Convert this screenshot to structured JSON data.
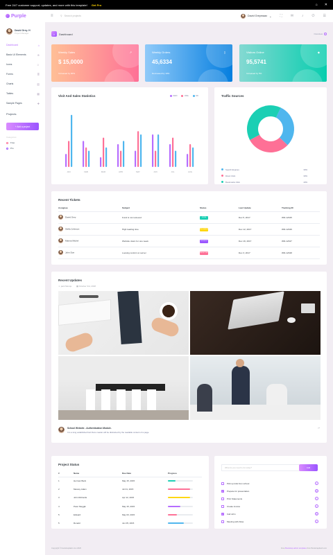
{
  "announcement": {
    "text": "Free 24/7 customer support, updates, and more with this template!",
    "cta": "Get Pro"
  },
  "topbar": {
    "brand": "Purple",
    "search_placeholder": "Search projects",
    "user": "David Greymaax"
  },
  "sidebar": {
    "profile_name": "David Grey. H",
    "profile_role": "Project Manager",
    "items": [
      {
        "label": "Dashboard",
        "icon": "home-icon"
      },
      {
        "label": "Basic UI Elements",
        "icon": "crosshairs-icon"
      },
      {
        "label": "Icons",
        "icon": "contacts-icon"
      },
      {
        "label": "Forms",
        "icon": "format-list-icon"
      },
      {
        "label": "Charts",
        "icon": "chart-bar-icon"
      },
      {
        "label": "Tables",
        "icon": "table-icon"
      },
      {
        "label": "Sample Pages",
        "icon": "medical-bag-icon"
      }
    ],
    "projects_title": "Projects",
    "add_project": "+ Add a project",
    "categories_title": "Categories",
    "categories": [
      "Free",
      "Pro"
    ]
  },
  "page": {
    "title": "Dashboard",
    "overview": "Overview"
  },
  "stats": [
    {
      "label": "Weekly Sales",
      "value": "$ 15,0000",
      "sub": "Increased by 60%",
      "icon": "chart-line-icon"
    },
    {
      "label": "Weekly Orders",
      "value": "45,6334",
      "sub": "Decreased by 10%",
      "icon": "bookmark-icon"
    },
    {
      "label": "Visitors Online",
      "value": "95,5741",
      "sub": "Increased by 5%",
      "icon": "diamond-icon"
    }
  ],
  "visit_chart": {
    "title": "Visit And Sales Statistics",
    "colors": {
      "CHN": "#b66dff",
      "USA": "#fe7096",
      "UK": "#4fb6ee"
    },
    "chart_data": {
      "type": "bar",
      "categories": [
        "JAN",
        "FEB",
        "MAR",
        "APR",
        "MAY",
        "JUN",
        "JUL",
        "AUG"
      ],
      "series": [
        {
          "name": "CHN",
          "values": [
            20,
            40,
            15,
            35,
            25,
            50,
            35,
            20
          ]
        },
        {
          "name": "USA",
          "values": [
            40,
            30,
            45,
            25,
            55,
            25,
            45,
            35
          ]
        },
        {
          "name": "UK",
          "values": [
            80,
            25,
            30,
            40,
            50,
            50,
            25,
            30
          ]
        }
      ],
      "ylim": [
        0,
        85
      ]
    }
  },
  "traffic": {
    "title": "Traffic Sources",
    "chart_data": {
      "type": "pie",
      "categories": [
        "Search Engines",
        "Direct Click",
        "Bookmarks Click"
      ],
      "values": [
        30,
        30,
        40
      ],
      "colors": [
        "#4fb6ee",
        "#fe7096",
        "#1bcfb4"
      ]
    },
    "legend": [
      {
        "label": "Search Engines",
        "pct": "30%"
      },
      {
        "label": "Direct Click",
        "pct": "30%"
      },
      {
        "label": "Bookmarks Click",
        "pct": "40%"
      }
    ]
  },
  "tickets": {
    "title": "Recent Tickets",
    "headers": [
      "Assignee",
      "Subject",
      "Status",
      "Last Update",
      "Tracking ID"
    ],
    "rows": [
      {
        "name": "David Grey",
        "subject": "Fund is not recieved",
        "status": "DONE",
        "color": "#1bcfb4",
        "date": "Dec 5, 2017",
        "id": "WD-12345"
      },
      {
        "name": "Stella Johnson",
        "subject": "High loading time",
        "status": "PROGRESS",
        "color": "#fed713",
        "date": "Dec 12, 2017",
        "id": "WD-12346"
      },
      {
        "name": "Marina Michel",
        "subject": "Website down for one week",
        "status": "ON HOLD",
        "color": "#9a55ff",
        "date": "Dec 16, 2017",
        "id": "WD-12347"
      },
      {
        "name": "John Doe",
        "subject": "Loosing control on server",
        "status": "REJECTED",
        "color": "#fe7096",
        "date": "Dec 3, 2017",
        "id": "WD-12348"
      }
    ]
  },
  "updates": {
    "title": "Recent Updates",
    "author": "jack Menqu",
    "date": "October 3rd, 2018",
    "story_title": "School Website - Authentication Module.",
    "story_text": "It is a long established fact that a reader will be distracted by the readable content of a page."
  },
  "project_status": {
    "title": "Project Status",
    "headers": [
      "#",
      "Name",
      "Due Date",
      "Progress"
    ],
    "rows": [
      {
        "n": "1",
        "name": "Herman Beck",
        "date": "May 15, 2015",
        "progress": 30,
        "color": "#1bcfb4"
      },
      {
        "n": "2",
        "name": "Messsy Adam",
        "date": "Jul 01, 2015",
        "progress": 90,
        "color": "#fe7096"
      },
      {
        "n": "3",
        "name": "John Richards",
        "date": "Apr 12, 2015",
        "progress": 90,
        "color": "#fed713"
      },
      {
        "n": "4",
        "name": "Peter Meggik",
        "date": "May 15, 2015",
        "progress": 50,
        "color": "#b66dff"
      },
      {
        "n": "5",
        "name": "Edward",
        "date": "May 03, 2015",
        "progress": 35,
        "color": "#fe7096"
      },
      {
        "n": "5",
        "name": "Ronald",
        "date": "Jun 05, 2015",
        "progress": 65,
        "color": "#4fb6ee"
      }
    ]
  },
  "todo": {
    "placeholder": "What do you need to do today?",
    "add": "Add",
    "items": [
      {
        "text": "Pick up kids from school",
        "done": false
      },
      {
        "text": "Prepare for presentation",
        "done": true
      },
      {
        "text": "Print Statements",
        "done": false
      },
      {
        "text": "Create invoice",
        "done": false
      },
      {
        "text": "Call John",
        "done": true
      },
      {
        "text": "Meeting with Alisa",
        "done": false
      }
    ]
  },
  "footer": {
    "left": "Copyright © bootstrapdash.com 2020",
    "pre": "Free",
    "link": "Bootstrap admin templates",
    "post": "from Bootstrapdash.com"
  }
}
